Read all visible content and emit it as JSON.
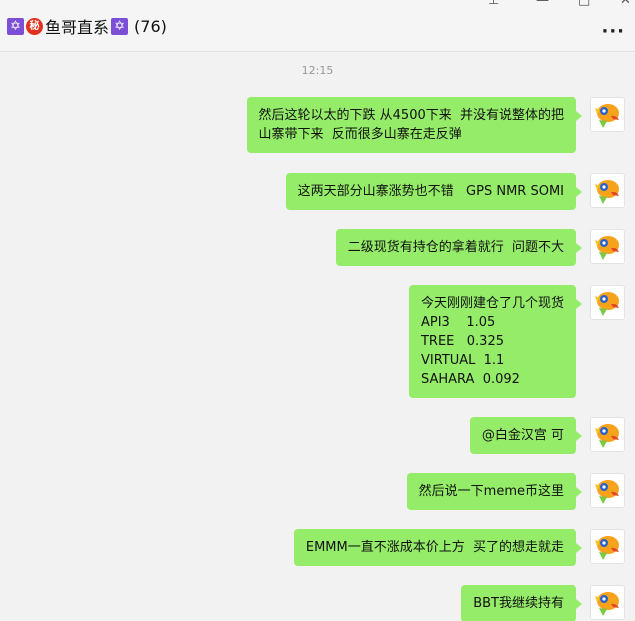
{
  "header": {
    "title": "鱼哥直系",
    "member_count": "(76)",
    "title_icons": [
      "star-of-david-icon",
      "secret-ideograph-icon",
      "star-of-david-icon"
    ],
    "menu_icon": "more-icon"
  },
  "chat": {
    "timestamp": "12:15",
    "bubble_color": "#95ec69",
    "messages": [
      {
        "lines": [
          "然后这轮以太的下跌 从4500下来  并没有说整体的把",
          "山寨带下来  反而很多山寨在走反弹"
        ]
      },
      {
        "lines": [
          "这两天部分山寨涨势也不错   GPS NMR SOMI"
        ]
      },
      {
        "lines": [
          "二级现货有持仓的拿着就行  问题不大"
        ]
      },
      {
        "lines": [
          "今天刚刚建仓了几个现货",
          "API3    1.05",
          "TREE   0.325",
          "VIRTUAL  1.1",
          "SAHARA  0.092"
        ]
      },
      {
        "lines": [
          "@白金汉宫 可"
        ]
      },
      {
        "lines": [
          "然后说一下meme币这里"
        ]
      },
      {
        "lines": [
          "EMMM一直不涨成本价上方  买了的想走就走"
        ]
      },
      {
        "lines": [
          "BBT我继续持有"
        ]
      }
    ]
  }
}
